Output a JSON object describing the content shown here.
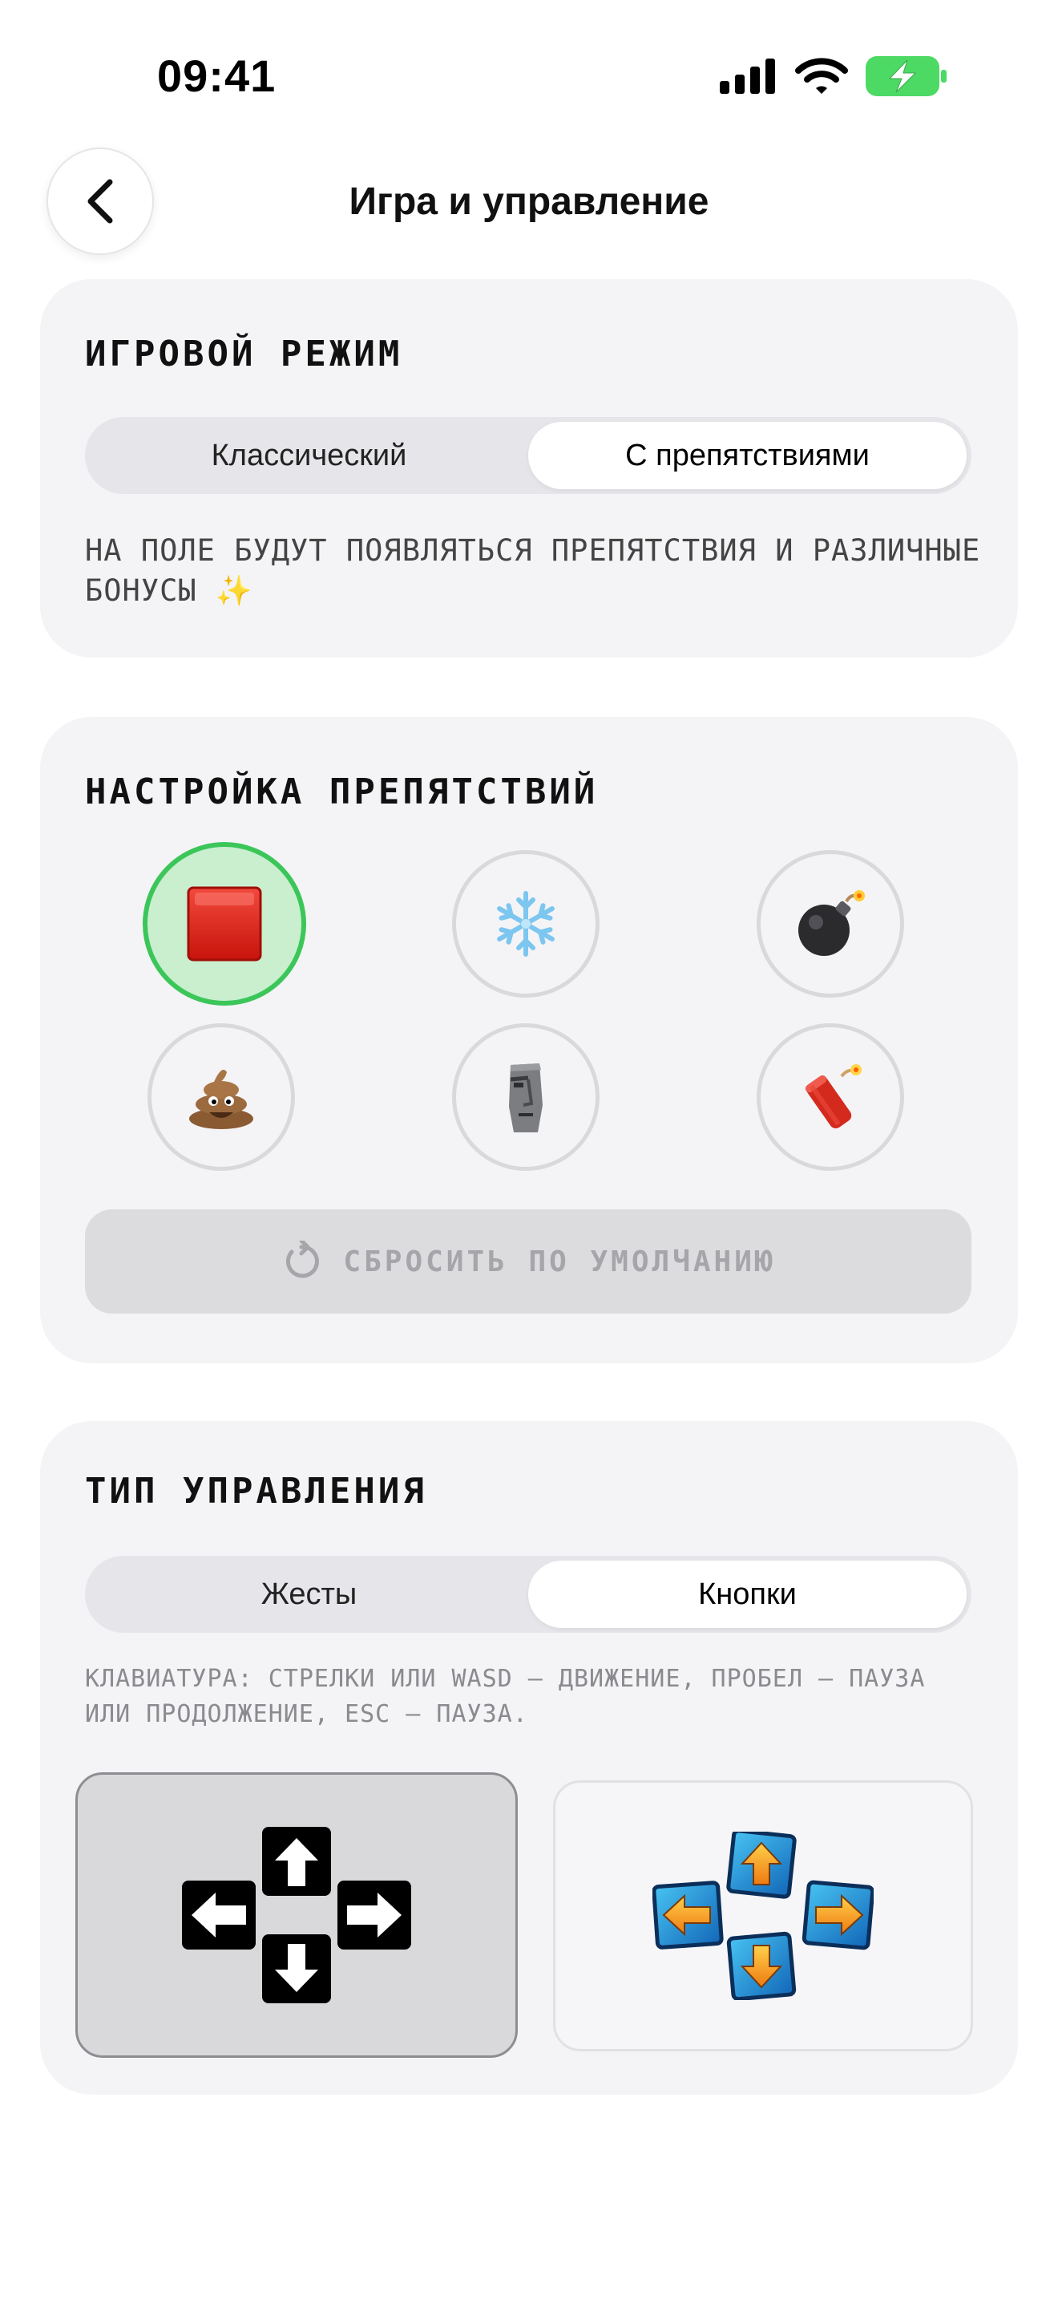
{
  "status_bar": {
    "time": "09:41",
    "icons": [
      "cellular-signal-icon",
      "wifi-icon",
      "battery-charging-icon"
    ]
  },
  "header": {
    "back_icon": "chevron-left-icon",
    "title": "Игра и управление"
  },
  "game_mode": {
    "title": "Игровой режим",
    "options": [
      "Классический",
      "С препятствиями"
    ],
    "selected": "С препятствиями",
    "description": "На поле будут появляться препятствия и различные бонусы ✨"
  },
  "obstacles": {
    "title": "Настройка препятствий",
    "items": [
      {
        "name": "red-square",
        "icon": "red-square-icon",
        "selected": true
      },
      {
        "name": "snowflake",
        "icon": "snowflake-icon",
        "selected": false
      },
      {
        "name": "bomb",
        "icon": "bomb-icon",
        "selected": false
      },
      {
        "name": "poop",
        "icon": "poop-icon",
        "selected": false
      },
      {
        "name": "moai",
        "icon": "moai-icon",
        "selected": false
      },
      {
        "name": "dynamite",
        "icon": "dynamite-icon",
        "selected": false
      }
    ],
    "reset_label": "Сбросить по умолчанию",
    "reset_icon": "reset-icon"
  },
  "control_type": {
    "title": "Тип управления",
    "options": [
      "Жесты",
      "Кнопки"
    ],
    "selected": "Кнопки",
    "description": "Клавиатура: стрелки или WASD — движение, пробел — пауза или продолжение, Esc — пауза.",
    "styles": [
      {
        "name": "pixel-arrows",
        "icon": "pixel-arrows-icon",
        "selected": true
      },
      {
        "name": "blue-dpad",
        "icon": "blue-dpad-icon",
        "selected": false
      }
    ]
  },
  "colors": {
    "accent_green": "#3cc65a",
    "selected_fill": "#c9efcf",
    "card_bg": "#f4f4f6"
  }
}
